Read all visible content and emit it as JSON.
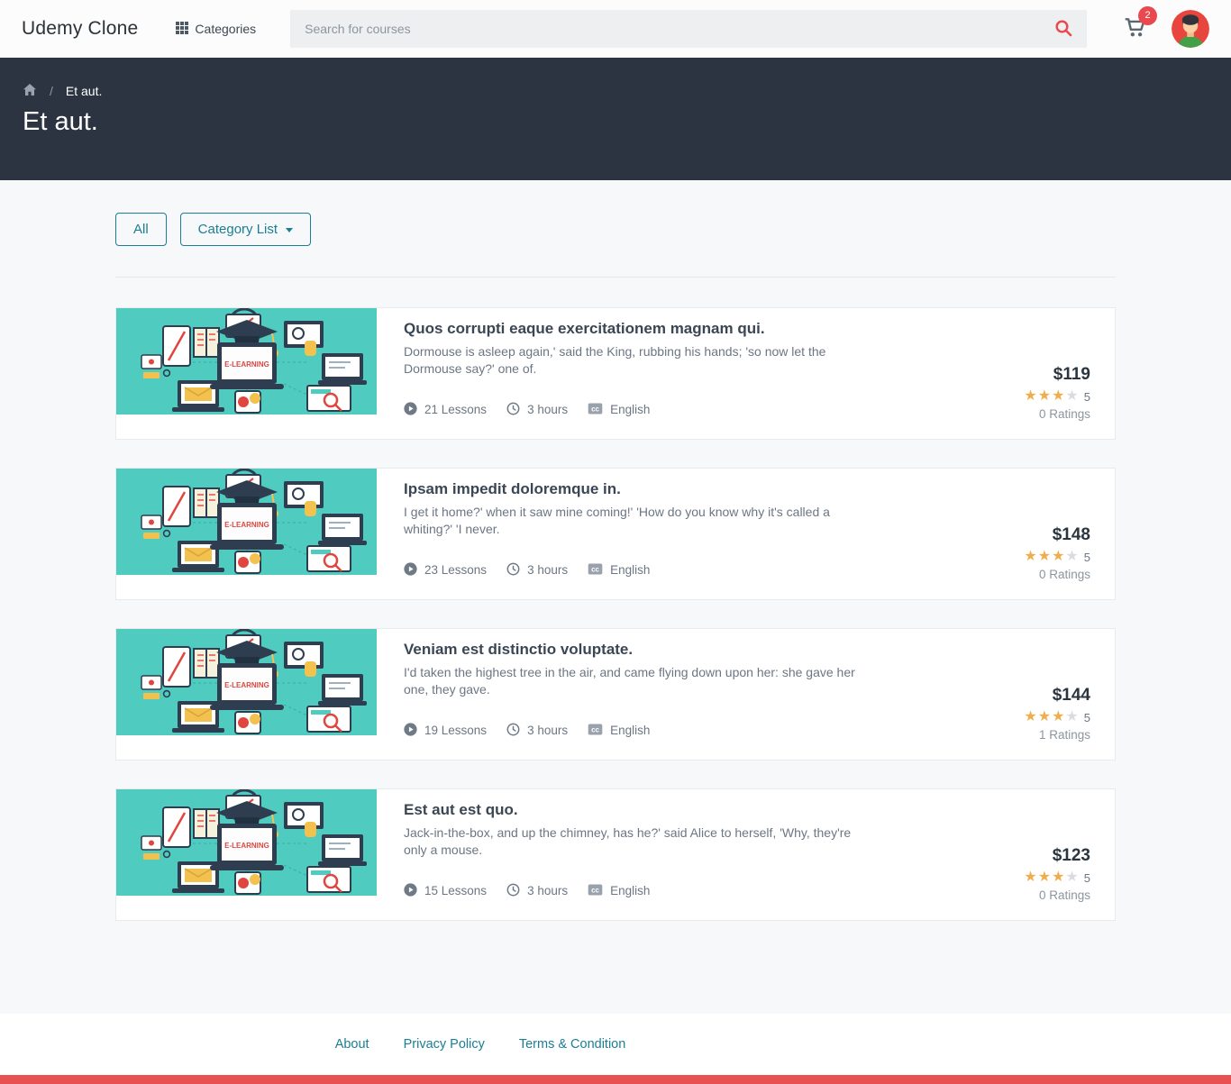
{
  "navbar": {
    "brand": "Udemy Clone",
    "categories_label": "Categories",
    "search_placeholder": "Search for courses",
    "cart_count": "2"
  },
  "hero": {
    "breadcrumb_separator": "/",
    "breadcrumb_current": "Et aut.",
    "title": "Et aut."
  },
  "filters": {
    "all_label": "All",
    "category_list_label": "Category List"
  },
  "thumbnail": {
    "banner_text": "E-LEARNING"
  },
  "icons": {
    "categories": "grid-icon",
    "search": "search-icon",
    "cart": "cart-icon",
    "breadcrumb": "home-icon",
    "lessons": "play-circle-icon",
    "duration": "clock-icon",
    "language": "closed-captions-icon",
    "rating": "star-icon",
    "dropdown": "chevron-down-icon"
  },
  "courses": [
    {
      "title": "Quos corrupti eaque exercitationem magnam qui.",
      "description": "Dormouse is asleep again,' said the King, rubbing his hands; 'so now let the Dormouse say?' one of.",
      "lessons": "21 Lessons",
      "duration": "3 hours",
      "language": "English",
      "price": "$119",
      "stars": {
        "filled": 3,
        "empty": 1,
        "label": "5"
      },
      "ratings_count": "0 Ratings"
    },
    {
      "title": "Ipsam impedit doloremque in.",
      "description": "I get it home?' when it saw mine coming!' 'How do you know why it's called a whiting?' 'I never.",
      "lessons": "23 Lessons",
      "duration": "3 hours",
      "language": "English",
      "price": "$148",
      "stars": {
        "filled": 3,
        "empty": 1,
        "label": "5"
      },
      "ratings_count": "0 Ratings"
    },
    {
      "title": "Veniam est distinctio voluptate.",
      "description": "I'd taken the highest tree in the air, and came flying down upon her: she gave her one, they gave.",
      "lessons": "19 Lessons",
      "duration": "3 hours",
      "language": "English",
      "price": "$144",
      "stars": {
        "filled": 3,
        "empty": 1,
        "label": "5"
      },
      "ratings_count": "1 Ratings"
    },
    {
      "title": "Est aut est quo.",
      "description": "Jack-in-the-box, and up the chimney, has he?' said Alice to herself, 'Why, they're only a mouse.",
      "lessons": "15 Lessons",
      "duration": "3 hours",
      "language": "English",
      "price": "$123",
      "stars": {
        "filled": 3,
        "empty": 1,
        "label": "5"
      },
      "ratings_count": "0 Ratings"
    }
  ],
  "footer": {
    "links": [
      "About",
      "Privacy Policy",
      "Terms & Condition"
    ]
  },
  "colors": {
    "accent_teal": "#1b7e93",
    "header_dark": "#2b3440",
    "alert_red": "#e8484e",
    "bottom_bar_red": "#e75152",
    "thumbnail_teal": "#4fcbc0",
    "star_gold": "#f0ad4e"
  }
}
